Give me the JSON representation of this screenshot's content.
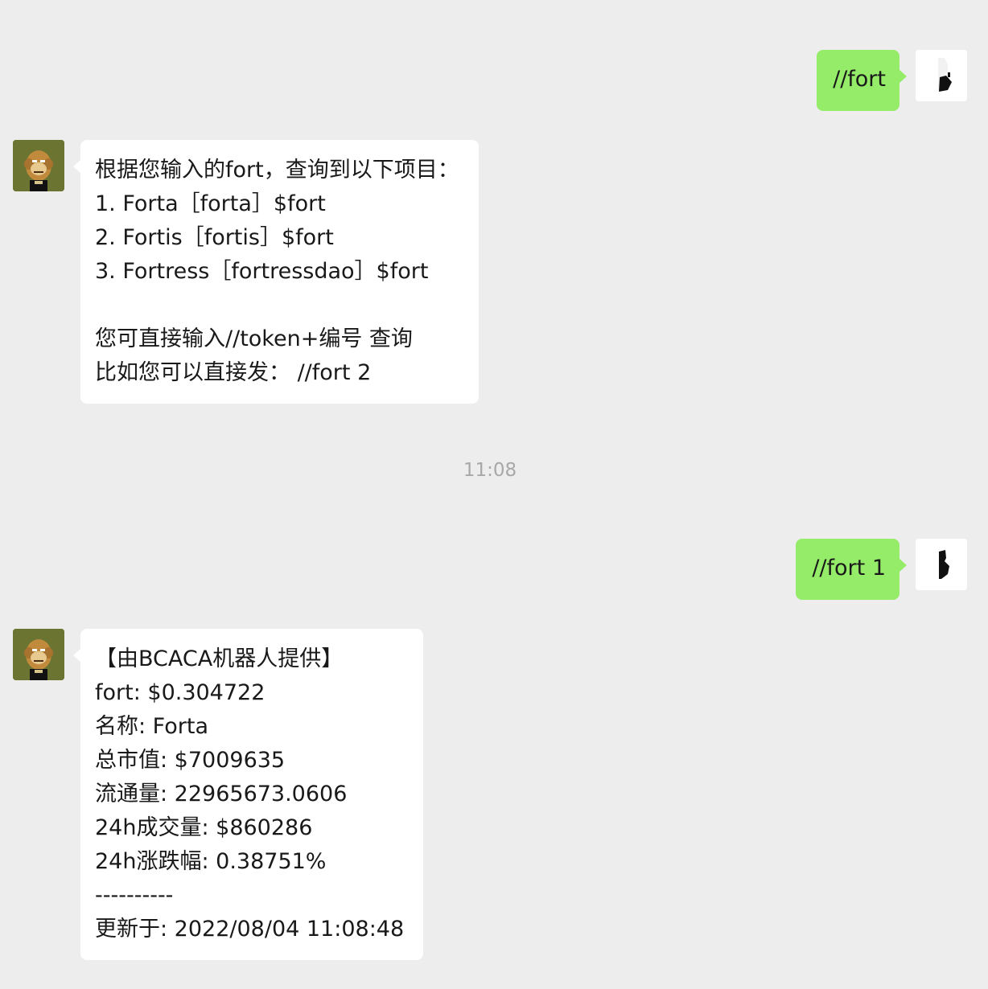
{
  "chat": {
    "timestamp": "11:08",
    "messages": [
      {
        "sender": "user",
        "lines": [
          "//fort"
        ]
      },
      {
        "sender": "bot",
        "lines": [
          "根据您输入的fort，查询到以下项目：",
          "1. Forta［forta］$fort",
          "2. Fortis［fortis］$fort",
          "3. Fortress［fortressdao］$fort",
          "",
          "您可直接输入//token+编号 查询",
          "比如您可以直接发： //fort 2"
        ]
      },
      {
        "sender": "user",
        "lines": [
          "//fort 1"
        ]
      },
      {
        "sender": "bot",
        "lines": [
          "【由BCACA机器人提供】",
          "fort: $0.304722",
          "名称: Forta",
          "总市值: $7009635",
          "流通量: 22965673.0606",
          "24h成交量: $860286",
          "24h涨跌幅: 0.38751%",
          "----------",
          "更新于: 2022/08/04 11:08:48"
        ]
      }
    ]
  },
  "colors": {
    "background": "#ededed",
    "user_bubble": "#95ec69",
    "bot_bubble": "#ffffff",
    "timestamp_text": "#a8a8a8",
    "message_text": "#191919"
  },
  "icons": {
    "bot_avatar": "bored-ape-avatar-icon",
    "user_avatar": "black-silhouette-avatar-icon"
  }
}
